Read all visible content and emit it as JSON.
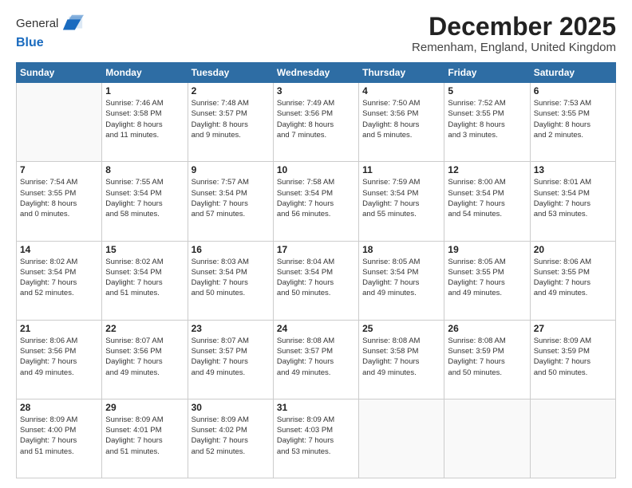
{
  "logo": {
    "general": "General",
    "blue": "Blue"
  },
  "title": "December 2025",
  "location": "Remenham, England, United Kingdom",
  "days_of_week": [
    "Sunday",
    "Monday",
    "Tuesday",
    "Wednesday",
    "Thursday",
    "Friday",
    "Saturday"
  ],
  "weeks": [
    [
      {
        "day": "",
        "info": ""
      },
      {
        "day": "1",
        "info": "Sunrise: 7:46 AM\nSunset: 3:58 PM\nDaylight: 8 hours\nand 11 minutes."
      },
      {
        "day": "2",
        "info": "Sunrise: 7:48 AM\nSunset: 3:57 PM\nDaylight: 8 hours\nand 9 minutes."
      },
      {
        "day": "3",
        "info": "Sunrise: 7:49 AM\nSunset: 3:56 PM\nDaylight: 8 hours\nand 7 minutes."
      },
      {
        "day": "4",
        "info": "Sunrise: 7:50 AM\nSunset: 3:56 PM\nDaylight: 8 hours\nand 5 minutes."
      },
      {
        "day": "5",
        "info": "Sunrise: 7:52 AM\nSunset: 3:55 PM\nDaylight: 8 hours\nand 3 minutes."
      },
      {
        "day": "6",
        "info": "Sunrise: 7:53 AM\nSunset: 3:55 PM\nDaylight: 8 hours\nand 2 minutes."
      }
    ],
    [
      {
        "day": "7",
        "info": "Sunrise: 7:54 AM\nSunset: 3:55 PM\nDaylight: 8 hours\nand 0 minutes."
      },
      {
        "day": "8",
        "info": "Sunrise: 7:55 AM\nSunset: 3:54 PM\nDaylight: 7 hours\nand 58 minutes."
      },
      {
        "day": "9",
        "info": "Sunrise: 7:57 AM\nSunset: 3:54 PM\nDaylight: 7 hours\nand 57 minutes."
      },
      {
        "day": "10",
        "info": "Sunrise: 7:58 AM\nSunset: 3:54 PM\nDaylight: 7 hours\nand 56 minutes."
      },
      {
        "day": "11",
        "info": "Sunrise: 7:59 AM\nSunset: 3:54 PM\nDaylight: 7 hours\nand 55 minutes."
      },
      {
        "day": "12",
        "info": "Sunrise: 8:00 AM\nSunset: 3:54 PM\nDaylight: 7 hours\nand 54 minutes."
      },
      {
        "day": "13",
        "info": "Sunrise: 8:01 AM\nSunset: 3:54 PM\nDaylight: 7 hours\nand 53 minutes."
      }
    ],
    [
      {
        "day": "14",
        "info": "Sunrise: 8:02 AM\nSunset: 3:54 PM\nDaylight: 7 hours\nand 52 minutes."
      },
      {
        "day": "15",
        "info": "Sunrise: 8:02 AM\nSunset: 3:54 PM\nDaylight: 7 hours\nand 51 minutes."
      },
      {
        "day": "16",
        "info": "Sunrise: 8:03 AM\nSunset: 3:54 PM\nDaylight: 7 hours\nand 50 minutes."
      },
      {
        "day": "17",
        "info": "Sunrise: 8:04 AM\nSunset: 3:54 PM\nDaylight: 7 hours\nand 50 minutes."
      },
      {
        "day": "18",
        "info": "Sunrise: 8:05 AM\nSunset: 3:54 PM\nDaylight: 7 hours\nand 49 minutes."
      },
      {
        "day": "19",
        "info": "Sunrise: 8:05 AM\nSunset: 3:55 PM\nDaylight: 7 hours\nand 49 minutes."
      },
      {
        "day": "20",
        "info": "Sunrise: 8:06 AM\nSunset: 3:55 PM\nDaylight: 7 hours\nand 49 minutes."
      }
    ],
    [
      {
        "day": "21",
        "info": "Sunrise: 8:06 AM\nSunset: 3:56 PM\nDaylight: 7 hours\nand 49 minutes."
      },
      {
        "day": "22",
        "info": "Sunrise: 8:07 AM\nSunset: 3:56 PM\nDaylight: 7 hours\nand 49 minutes."
      },
      {
        "day": "23",
        "info": "Sunrise: 8:07 AM\nSunset: 3:57 PM\nDaylight: 7 hours\nand 49 minutes."
      },
      {
        "day": "24",
        "info": "Sunrise: 8:08 AM\nSunset: 3:57 PM\nDaylight: 7 hours\nand 49 minutes."
      },
      {
        "day": "25",
        "info": "Sunrise: 8:08 AM\nSunset: 3:58 PM\nDaylight: 7 hours\nand 49 minutes."
      },
      {
        "day": "26",
        "info": "Sunrise: 8:08 AM\nSunset: 3:59 PM\nDaylight: 7 hours\nand 50 minutes."
      },
      {
        "day": "27",
        "info": "Sunrise: 8:09 AM\nSunset: 3:59 PM\nDaylight: 7 hours\nand 50 minutes."
      }
    ],
    [
      {
        "day": "28",
        "info": "Sunrise: 8:09 AM\nSunset: 4:00 PM\nDaylight: 7 hours\nand 51 minutes."
      },
      {
        "day": "29",
        "info": "Sunrise: 8:09 AM\nSunset: 4:01 PM\nDaylight: 7 hours\nand 51 minutes."
      },
      {
        "day": "30",
        "info": "Sunrise: 8:09 AM\nSunset: 4:02 PM\nDaylight: 7 hours\nand 52 minutes."
      },
      {
        "day": "31",
        "info": "Sunrise: 8:09 AM\nSunset: 4:03 PM\nDaylight: 7 hours\nand 53 minutes."
      },
      {
        "day": "",
        "info": ""
      },
      {
        "day": "",
        "info": ""
      },
      {
        "day": "",
        "info": ""
      }
    ]
  ]
}
